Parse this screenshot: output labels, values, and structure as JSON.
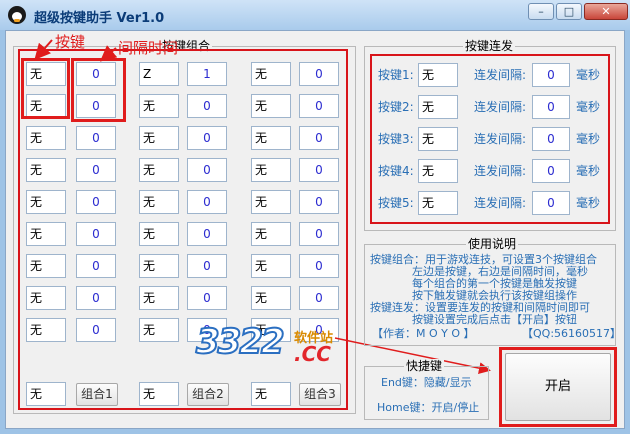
{
  "window": {
    "title": "超级按键助手 Ver1.0",
    "minimize": "–",
    "maximize": "□",
    "close": "✕"
  },
  "combo": {
    "group_label": "按键组合",
    "rows": [
      [
        {
          "key": "无",
          "interval": "0"
        },
        {
          "key": "Z",
          "interval": "1"
        },
        {
          "key": "无",
          "interval": "0"
        }
      ],
      [
        {
          "key": "无",
          "interval": "0"
        },
        {
          "key": "无",
          "interval": "0"
        },
        {
          "key": "无",
          "interval": "0"
        }
      ],
      [
        {
          "key": "无",
          "interval": "0"
        },
        {
          "key": "无",
          "interval": "0"
        },
        {
          "key": "无",
          "interval": "0"
        }
      ],
      [
        {
          "key": "无",
          "interval": "0"
        },
        {
          "key": "无",
          "interval": "0"
        },
        {
          "key": "无",
          "interval": "0"
        }
      ],
      [
        {
          "key": "无",
          "interval": "0"
        },
        {
          "key": "无",
          "interval": "0"
        },
        {
          "key": "无",
          "interval": "0"
        }
      ],
      [
        {
          "key": "无",
          "interval": "0"
        },
        {
          "key": "无",
          "interval": "0"
        },
        {
          "key": "无",
          "interval": "0"
        }
      ],
      [
        {
          "key": "无",
          "interval": "0"
        },
        {
          "key": "无",
          "interval": "0"
        },
        {
          "key": "无",
          "interval": "0"
        }
      ],
      [
        {
          "key": "无",
          "interval": "0"
        },
        {
          "key": "无",
          "interval": "0"
        },
        {
          "key": "无",
          "interval": "0"
        }
      ],
      [
        {
          "key": "无",
          "interval": "0"
        },
        {
          "key": "无",
          "interval": "0"
        },
        {
          "key": "无",
          "interval": "0"
        }
      ]
    ],
    "bottom": [
      {
        "key": "无",
        "button": "组合1"
      },
      {
        "key": "无",
        "button": "组合2"
      },
      {
        "key": "无",
        "button": "组合3"
      }
    ]
  },
  "annotations": {
    "key": "按键",
    "interval": "间隔时间"
  },
  "repeat": {
    "group_label": "按键连发",
    "interval_label": "连发间隔:",
    "unit": "毫秒",
    "items": [
      {
        "label": "按键1:",
        "key": "无",
        "interval": "0"
      },
      {
        "label": "按键2:",
        "key": "无",
        "interval": "0"
      },
      {
        "label": "按键3:",
        "key": "无",
        "interval": "0"
      },
      {
        "label": "按键4:",
        "key": "无",
        "interval": "0"
      },
      {
        "label": "按键5:",
        "key": "无",
        "interval": "0"
      }
    ]
  },
  "help": {
    "group_label": "使用说明",
    "lines": [
      "按键组合：用于游戏连技，可设置3个按键组合",
      "左边是按键，右边是间隔时间，毫秒",
      "每个组合的第一个按键是触发按键",
      "按下触发键就会执行该按键组操作",
      "按键连发：设置要连发的按键和间隔时间即可",
      "按键设置完成后点击【开启】按钮"
    ],
    "author": "【作者：M O Y O 】",
    "qq": "【QQ:56160517】"
  },
  "hotkeys": {
    "group_label": "快捷键",
    "line1": "End键：隐藏/显示",
    "line2": "Home键：开启/停止"
  },
  "start_button": "开启",
  "watermark": {
    "number": "3322",
    "cn": "软件站",
    "domain": ".CC"
  },
  "colors": {
    "accent_red": "#e01c1c",
    "text_blue": "#2a6fb5",
    "title_blue": "#0b3c78"
  }
}
